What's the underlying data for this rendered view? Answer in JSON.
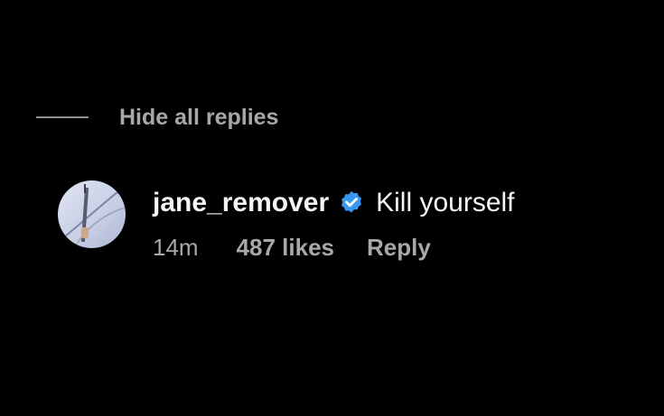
{
  "replies": {
    "hide_label": "Hide all replies"
  },
  "comment": {
    "username": "jane_remover",
    "verified_icon": "verified-badge-icon",
    "verified_color": "#3897f0",
    "text": "Kill yourself",
    "time": "14m",
    "likes": "487 likes",
    "reply_label": "Reply"
  },
  "colors": {
    "background": "#000000",
    "primary_text": "#f5f5f5",
    "secondary_text": "#a8a8a8"
  }
}
